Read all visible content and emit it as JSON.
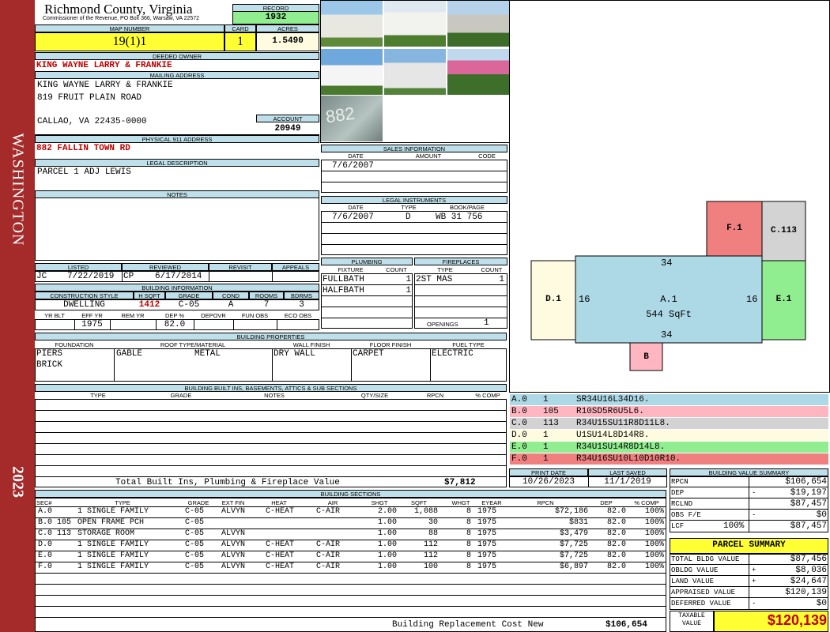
{
  "side": {
    "label": "WASHINGTON",
    "year": "2023"
  },
  "header": {
    "county": "Richmond County, Virginia",
    "commissioner": "Commissioner of the Revenue, PO Box 366, Warsaw, VA 22572",
    "record_label": "RECORD",
    "record": "1932"
  },
  "parcel": {
    "map_label": "MAP NUMBER",
    "map": "19(1)1",
    "card_label": "CARD",
    "card": "1",
    "acres_label": "ACRES",
    "acres": "1.5490"
  },
  "owner": {
    "deeded_label": "DEEDED OWNER",
    "deeded": "KING WAYNE LARRY & FRANKIE",
    "mailing_label": "MAILING ADDRESS",
    "line1": "KING WAYNE LARRY & FRANKIE",
    "line2": "819 FRUIT PLAIN ROAD",
    "line3": "CALLAO, VA 22435-0000",
    "account_label": "ACCOUNT",
    "account": "20949"
  },
  "physical": {
    "label": "PHYSICAL 911 ADDRESS",
    "address": "882 FALLIN TOWN RD"
  },
  "legal": {
    "label": "LEGAL DESCRIPTION",
    "text": "PARCEL 1 ADJ LEWIS"
  },
  "notes": {
    "label": "NOTES"
  },
  "listing": {
    "listed_label": "LISTED",
    "reviewed_label": "REVIEWED",
    "revisit_label": "REVISIT",
    "appeals_label": "APPEALS",
    "listed_by": "JC",
    "listed_date": "7/22/2019",
    "reviewed_by": "CP",
    "reviewed_date": "6/17/2014"
  },
  "building_info": {
    "label": "BUILDING INFORMATION",
    "h": {
      "style": "CONSTRUCTION STYLE",
      "hsqft": "H SQFT",
      "grade": "GRADE",
      "cond": "COND",
      "rooms": "ROOMS",
      "bdrms": "BDRMS",
      "yrblt": "YR BLT",
      "effyr": "EFF YR",
      "remyr": "REM YR",
      "dep": "DEP %",
      "depovr": "DEPOVR",
      "funobs": "FUN OBS",
      "ecoobs": "ECO OBS"
    },
    "style": "DWELLING",
    "hsqft": "1412",
    "grade": "C-05",
    "cond": "A",
    "rooms": "7",
    "bdrms": "3",
    "effyr": "1975",
    "dep": "82.0"
  },
  "properties": {
    "label": "BUILDING PROPERTIES",
    "h": {
      "foundation": "FOUNDATION",
      "roof": "ROOF TYPE/MATERIAL",
      "wall": "WALL FINISH",
      "floor": "FLOOR FINISH",
      "fuel": "FUEL TYPE"
    },
    "foundation1": "PIERS",
    "foundation2": "BRICK",
    "roof_type": "GABLE",
    "roof_mat": "METAL",
    "wall": "DRY WALL",
    "floor": "CARPET",
    "fuel": "ELECTRIC"
  },
  "builtins": {
    "label": "BUILDING BUILT INS, BASEMENTS, ATTICS & SUB SECTIONS",
    "h": {
      "type": "TYPE",
      "grade": "GRADE",
      "notes": "NOTES",
      "qty": "QTY/SIZE",
      "rpcn": "RPCN",
      "comp": "% COMP"
    },
    "total_label": "Total Built Ins, Plumbing & Fireplace Value",
    "total": "$7,812"
  },
  "sales": {
    "label": "SALES INFORMATION",
    "h": {
      "date": "DATE",
      "amount": "AMOUNT",
      "code": "CODE"
    },
    "date": "7/6/2007"
  },
  "instruments": {
    "label": "LEGAL INSTRUMENTS",
    "h": {
      "date": "DATE",
      "type": "TYPE",
      "book": "BOOK/PAGE"
    },
    "date": "7/6/2007",
    "type": "D",
    "book": "WB 31 756"
  },
  "plumbing": {
    "label": "PLUMBING",
    "h": {
      "fixture": "FIXTURE",
      "count": "COUNT"
    },
    "rows": [
      {
        "fixture": "FULLBATH",
        "count": "1"
      },
      {
        "fixture": "HALFBATH",
        "count": "1"
      }
    ]
  },
  "fireplaces": {
    "label": "FIREPLACES",
    "h": {
      "type": "TYPE",
      "count": "COUNT"
    },
    "type": "2ST MAS",
    "count": "1",
    "openings_label": "OPENINGS",
    "openings": "1"
  },
  "sketch": {
    "a_label": "A.1",
    "a_area": "544 SqFt",
    "a_top": "34",
    "a_bottom": "34",
    "a_left": "16",
    "a_right": "16",
    "f_label": "F.1",
    "c_label": "C.113",
    "d_label": "D.1",
    "e_label": "E.1",
    "b_label": "B",
    "colors": {
      "a": "#add8e6",
      "b": "#ffb6c1",
      "c": "#d3d3d3",
      "d": "#fffbe0",
      "e": "#90ee90",
      "f": "#f08080"
    }
  },
  "segments": [
    {
      "id": "A.0",
      "n": "1",
      "code": "SR34U16L34D16.",
      "color": "#add8e6"
    },
    {
      "id": "B.0",
      "n": "105",
      "code": "R10SD5R6U5L6.",
      "color": "#ffb6c1"
    },
    {
      "id": "C.0",
      "n": "113",
      "code": "R34U15SU11R8D11L8.",
      "color": "#d3d3d3"
    },
    {
      "id": "D.0",
      "n": "1",
      "code": "U1SU14L8D14R8.",
      "color": "#fffbe0"
    },
    {
      "id": "E.0",
      "n": "1",
      "code": "R34U1SU14R8D14L8.",
      "color": "#90ee90"
    },
    {
      "id": "F.0",
      "n": "1",
      "code": "R34U16SU10L10D10R10.",
      "color": "#f08080"
    }
  ],
  "print": {
    "print_label": "PRINT DATE",
    "saved_label": "LAST SAVED",
    "print_date": "10/26/2023",
    "saved_date": "11/1/2019"
  },
  "bvs": {
    "label": "BUILDING VALUE SUMMARY",
    "rpcn_label": "RPCN",
    "rpcn": "$106,654",
    "dep_label": "DEP",
    "dep_sign": "-",
    "dep": "$19,197",
    "rclnd_label": "RCLND",
    "rclnd": "$87,457",
    "obs_label": "OBS F/E",
    "obs_sign": "-",
    "obs": "$0",
    "lcf_label": "LCF",
    "lcf_pct": "100%",
    "lcf": "$87,457"
  },
  "summary": {
    "label": "PARCEL SUMMARY",
    "bldg_label": "TOTAL BLDG VALUE",
    "bldg": "$87,456",
    "obldg_label": "OBLDG VALUE",
    "obldg_sign": "+",
    "obldg": "$8,036",
    "land_label": "LAND VALUE",
    "land_sign": "+",
    "land": "$24,647",
    "appraised_label": "APPRAISED VALUE",
    "appraised": "$120,139",
    "deferred_label": "DEFERRED VALUE",
    "deferred_sign": "-",
    "deferred": "$0",
    "taxable_label1": "TAXABLE",
    "taxable_label2": "VALUE",
    "taxable": "$120,139"
  },
  "sections": {
    "label": "BUILDING SECTIONS",
    "h": {
      "sec": "SEC#",
      "type": "TYPE",
      "grade": "GRADE",
      "extfin": "EXT FIN",
      "heat": "HEAT",
      "air": "AIR",
      "shgt": "SHGT",
      "sqft": "SQFT",
      "whgt": "WHGT",
      "eyear": "EYEAR",
      "rpcn": "RPCN",
      "dep": "DEP",
      "comp": "% COMP"
    },
    "rows": [
      {
        "sec": "A.0",
        "code": "1",
        "type": "SINGLE FAMILY",
        "grade": "C-05",
        "extfin": "ALVYN",
        "heat": "C-HEAT",
        "air": "C-AIR",
        "shgt": "2.00",
        "sqft": "1,088",
        "whgt": "8",
        "eyear": "1975",
        "rpcn": "$72,186",
        "dep": "82.0",
        "comp": "100%"
      },
      {
        "sec": "B.0",
        "code": "105",
        "type": "OPEN FRAME PCH",
        "grade": "C-05",
        "extfin": "",
        "heat": "",
        "air": "",
        "shgt": "1.00",
        "sqft": "30",
        "whgt": "8",
        "eyear": "1975",
        "rpcn": "$831",
        "dep": "82.0",
        "comp": "100%"
      },
      {
        "sec": "C.0",
        "code": "113",
        "type": "STORAGE ROOM",
        "grade": "C-05",
        "extfin": "ALVYN",
        "heat": "",
        "air": "",
        "shgt": "1.00",
        "sqft": "88",
        "whgt": "8",
        "eyear": "1975",
        "rpcn": "$3,479",
        "dep": "82.0",
        "comp": "100%"
      },
      {
        "sec": "D.0",
        "code": "1",
        "type": "SINGLE FAMILY",
        "grade": "C-05",
        "extfin": "ALVYN",
        "heat": "C-HEAT",
        "air": "C-AIR",
        "shgt": "1.00",
        "sqft": "112",
        "whgt": "8",
        "eyear": "1975",
        "rpcn": "$7,725",
        "dep": "82.0",
        "comp": "100%"
      },
      {
        "sec": "E.0",
        "code": "1",
        "type": "SINGLE FAMILY",
        "grade": "C-05",
        "extfin": "ALVYN",
        "heat": "C-HEAT",
        "air": "C-AIR",
        "shgt": "1.00",
        "sqft": "112",
        "whgt": "8",
        "eyear": "1975",
        "rpcn": "$7,725",
        "dep": "82.0",
        "comp": "100%"
      },
      {
        "sec": "F.0",
        "code": "1",
        "type": "SINGLE FAMILY",
        "grade": "C-05",
        "extfin": "ALVYN",
        "heat": "C-HEAT",
        "air": "C-AIR",
        "shgt": "1.00",
        "sqft": "100",
        "whgt": "8",
        "eyear": "1975",
        "rpcn": "$6,897",
        "dep": "82.0",
        "comp": "100%"
      }
    ],
    "total_label": "Building Replacement Cost New",
    "total": "$106,654"
  },
  "photo_number": "882"
}
